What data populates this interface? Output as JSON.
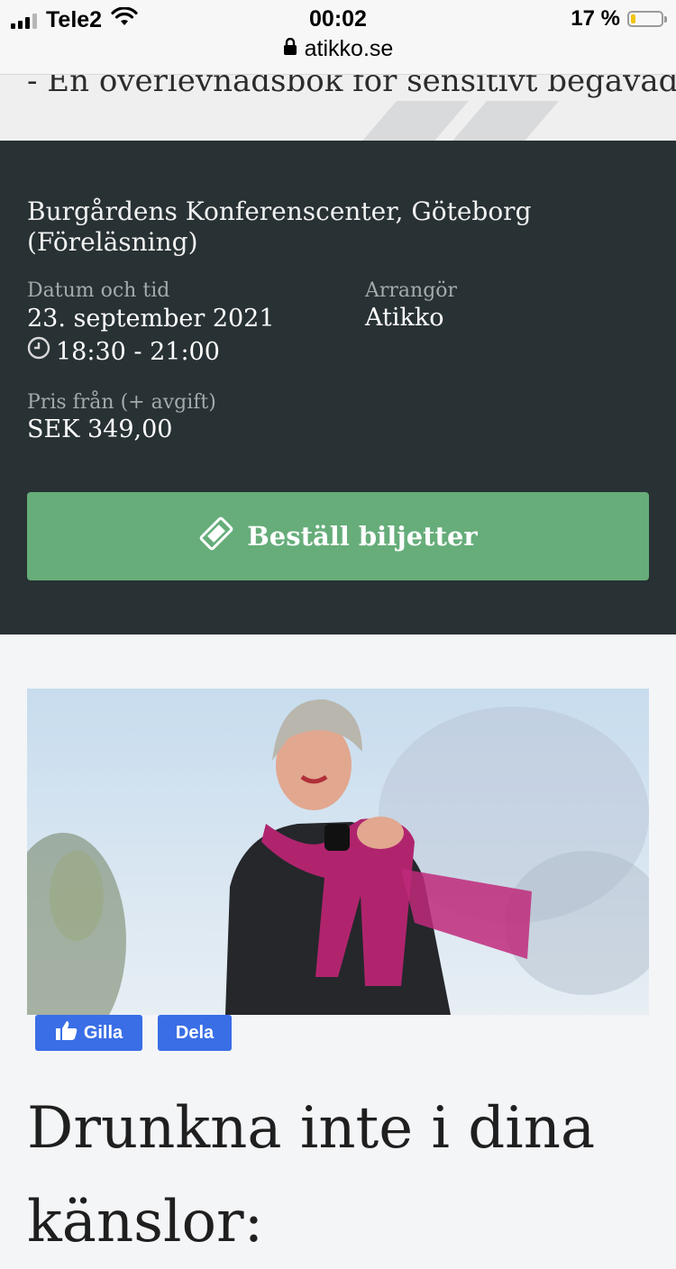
{
  "status_bar": {
    "carrier": "Tele2",
    "time": "00:02",
    "url": "atikko.se",
    "battery_text": "17 %",
    "battery_level": 0.17
  },
  "header": {
    "subtitle": "- En överlevnadsbok för sensitivt begåvade"
  },
  "event": {
    "venue": "Burgårdens Konferenscenter, Göteborg (Föreläsning)",
    "date_label": "Datum och tid",
    "date": "23. september 2021",
    "time": "18:30 - 21:00",
    "organizer_label": "Arrangör",
    "organizer": "Atikko",
    "price_label": "Pris från (+ avgift)",
    "price": "SEK 349,00",
    "buy_label": "Beställ biljetter"
  },
  "social": {
    "like_label": "Gilla",
    "share_label": "Dela"
  },
  "article": {
    "title": "Drunkna inte i dina känslor:"
  },
  "colors": {
    "panel": "#283134",
    "button": "#66ad7a",
    "facebook": "#3a6ee6"
  },
  "icons": [
    "signal-icon",
    "wifi-icon",
    "lock-icon",
    "battery-icon",
    "clock-icon",
    "ticket-icon",
    "thumbs-up-icon"
  ]
}
